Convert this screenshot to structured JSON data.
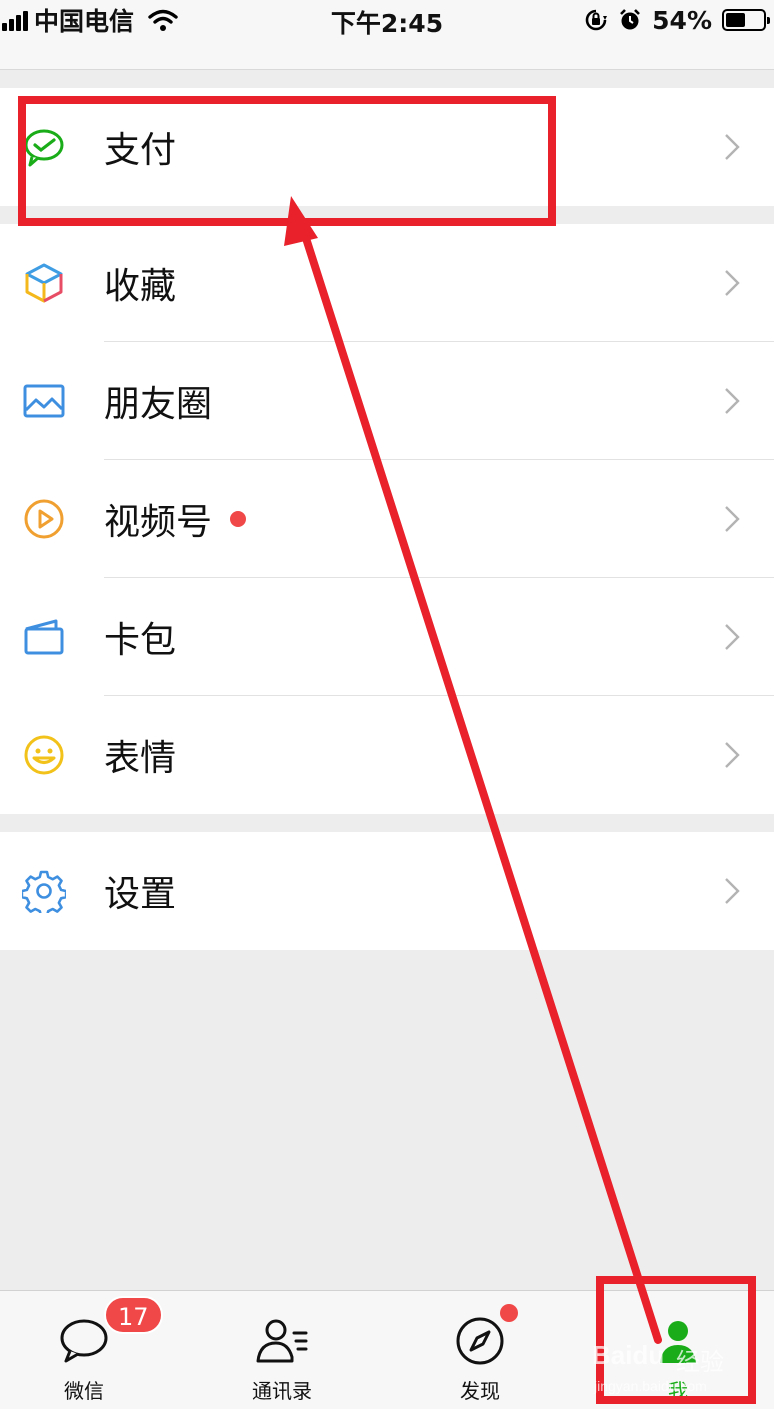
{
  "status_bar": {
    "carrier": "中国电信",
    "time": "下午2:45",
    "battery_percent": "54%",
    "battery_level": 0.54,
    "icons": [
      "signal-icon",
      "wifi-icon",
      "orientation-lock-icon",
      "alarm-icon",
      "battery-icon"
    ]
  },
  "menu": {
    "pay": {
      "label": "支付",
      "icon": "wechat-pay-icon"
    },
    "items": [
      {
        "label": "收藏",
        "icon": "favorites-cube-icon"
      },
      {
        "label": "朋友圈",
        "icon": "moments-image-icon"
      },
      {
        "label": "视频号",
        "icon": "channels-play-icon",
        "has_dot": true
      },
      {
        "label": "卡包",
        "icon": "card-wallet-icon"
      },
      {
        "label": "表情",
        "icon": "sticker-smile-icon"
      }
    ],
    "settings": {
      "label": "设置",
      "icon": "settings-gear-icon"
    }
  },
  "tab_bar": {
    "tabs": [
      {
        "label": "微信",
        "icon": "chat-bubble-icon",
        "badge": "17"
      },
      {
        "label": "通讯录",
        "icon": "contacts-icon"
      },
      {
        "label": "发现",
        "icon": "compass-icon",
        "has_dot": true
      },
      {
        "label": "我",
        "icon": "me-person-icon",
        "active": true
      }
    ]
  },
  "watermark": {
    "brand": "Baidu",
    "suffix": "经验",
    "site": "jingyan.baidu.com"
  },
  "colors": {
    "annotation_red": "#e8212b",
    "wechat_green": "#1aad19",
    "badge_red": "#f04848",
    "background": "#ededed"
  }
}
